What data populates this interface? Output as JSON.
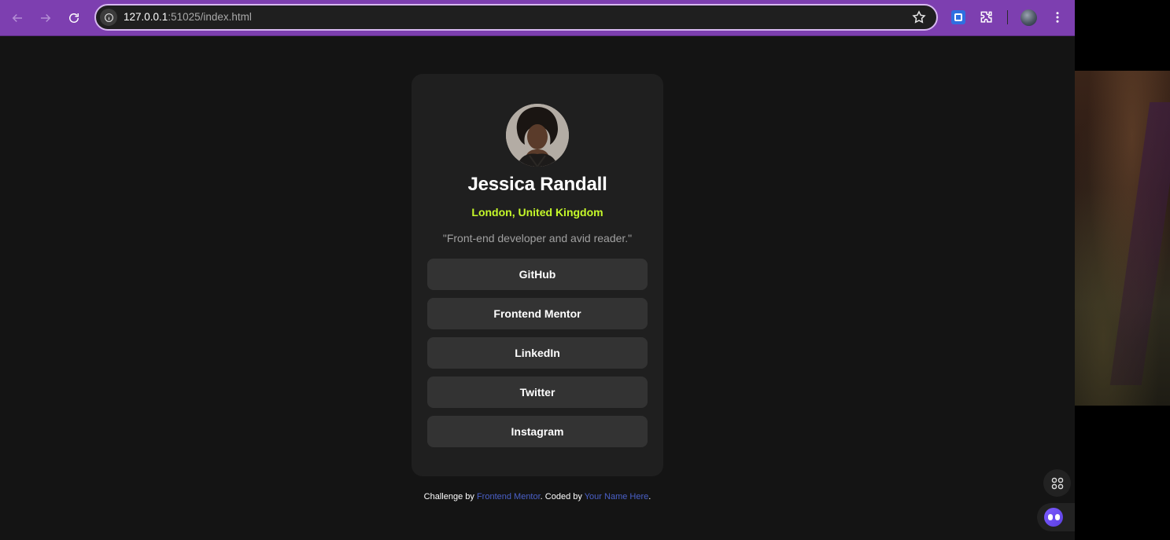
{
  "browser": {
    "url_host": "127.0.0.1",
    "url_rest": ":51025/index.html"
  },
  "profile": {
    "name": "Jessica Randall",
    "location": "London, United Kingdom",
    "bio": "\"Front-end developer and avid reader.\""
  },
  "links": [
    {
      "label": "GitHub"
    },
    {
      "label": "Frontend Mentor"
    },
    {
      "label": "LinkedIn"
    },
    {
      "label": "Twitter"
    },
    {
      "label": "Instagram"
    }
  ],
  "footer": {
    "prefix": "Challenge by ",
    "challenge_link": "Frontend Mentor",
    "middle": ". Coded by ",
    "author_link": "Your Name Here",
    "suffix": "."
  },
  "colors": {
    "toolbar": "#7d3fb0",
    "page_bg": "#141414",
    "card_bg": "#1f1f1f",
    "button_bg": "#333333",
    "accent_green": "#c5f82a",
    "link_blue": "#4a60c8"
  }
}
